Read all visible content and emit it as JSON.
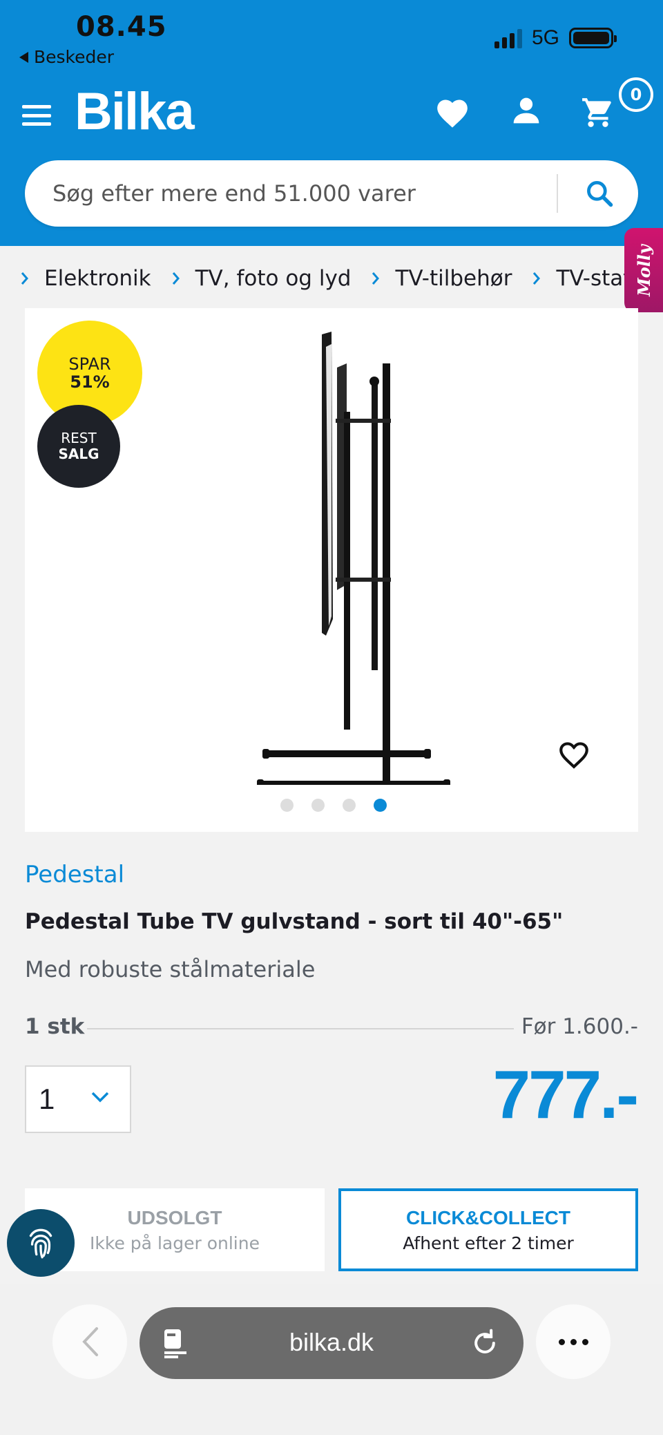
{
  "status_bar": {
    "time": "08.45",
    "back_label": "Beskeder",
    "network": "5G"
  },
  "header": {
    "logo": "Bilka",
    "cart_count": "0",
    "brand_color": "#0a8ad6"
  },
  "search": {
    "placeholder": "Søg efter mere end 51.000 varer"
  },
  "breadcrumb": {
    "items": [
      "Elektronik",
      "TV, foto og lyd",
      "TV-tilbehør",
      "TV-stative"
    ]
  },
  "assistant_tab": {
    "label": "Molly"
  },
  "product": {
    "badge_spar_top": "SPAR",
    "badge_spar_value": "51%",
    "badge_rest_top": "REST",
    "badge_rest_bottom": "SALG",
    "image_count": 4,
    "active_image_index": 4,
    "category": "Pedestal",
    "title": "Pedestal Tube TV gulvstand - sort til 40\"-65\"",
    "subtitle": "Med robuste stålmateriale",
    "unit": "1 stk",
    "price_before": "Før 1.600.-",
    "quantity": "1",
    "price": "777.-"
  },
  "actions": {
    "sold_out_title": "UDSOLGT",
    "sold_out_sub": "Ikke på lager online",
    "cc_title": "CLICK&COLLECT",
    "cc_sub": "Afhent efter 2 timer"
  },
  "browser": {
    "url": "bilka.dk"
  }
}
